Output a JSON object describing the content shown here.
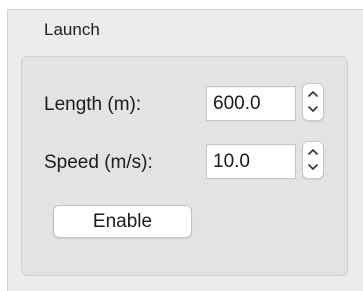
{
  "group": {
    "title": "Launch"
  },
  "fields": {
    "length": {
      "label": "Length (m):",
      "value": "600.0"
    },
    "speed": {
      "label": "Speed (m/s):",
      "value": "10.0"
    }
  },
  "buttons": {
    "enable_label": "Enable"
  },
  "icons": {
    "stepper_up": "chevron-up-icon",
    "stepper_down": "chevron-down-icon"
  }
}
